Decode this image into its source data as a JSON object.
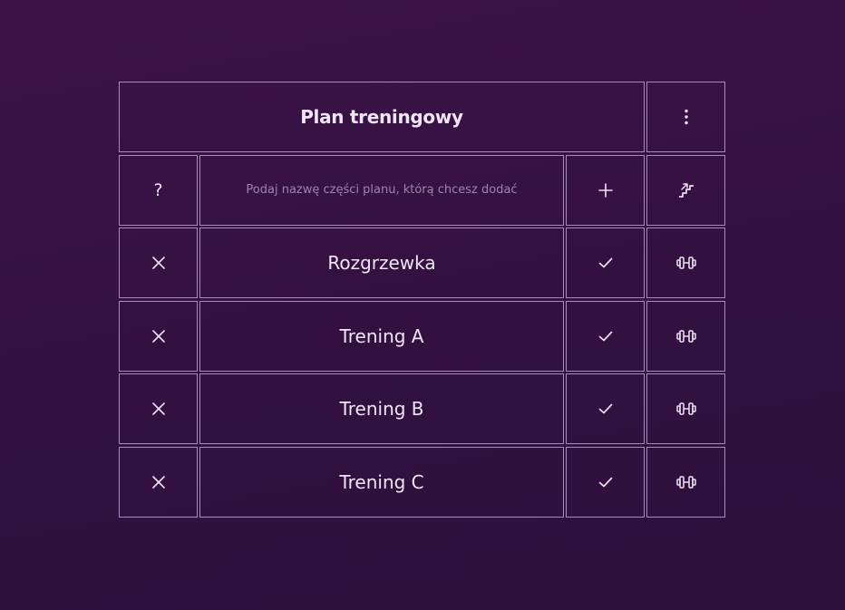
{
  "plan": {
    "title": "Plan treningowy",
    "menu_icon": "kebab-menu-icon"
  },
  "add_row": {
    "help_label": "?",
    "input_value": "",
    "input_placeholder": "Podaj nazwę części planu, którą chcesz dodać",
    "add_icon": "plus-icon",
    "extra_icon": "stairs-icon"
  },
  "parts": [
    {
      "name": "Rozgrzewka",
      "delete_icon": "close-icon",
      "confirm_icon": "check-icon",
      "exercise_icon": "dumbbell-icon"
    },
    {
      "name": "Trening A",
      "delete_icon": "close-icon",
      "confirm_icon": "check-icon",
      "exercise_icon": "dumbbell-icon"
    },
    {
      "name": "Trening B",
      "delete_icon": "close-icon",
      "confirm_icon": "check-icon",
      "exercise_icon": "dumbbell-icon"
    },
    {
      "name": "Trening C",
      "delete_icon": "close-icon",
      "confirm_icon": "check-icon",
      "exercise_icon": "dumbbell-icon"
    }
  ],
  "colors": {
    "background": "#3a1247",
    "border": "#a98bbc",
    "text": "#ece4f3",
    "placeholder": "#9c86ab"
  }
}
